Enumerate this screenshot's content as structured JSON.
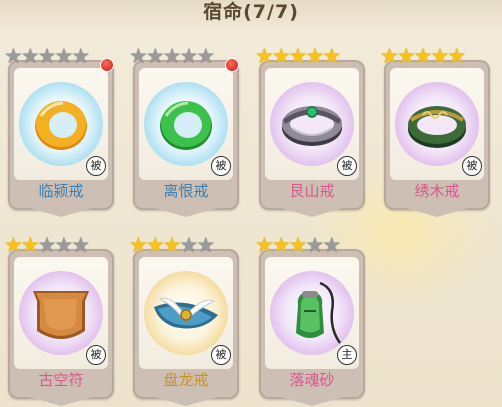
{
  "header": {
    "title": "宿命(7/7)"
  },
  "cards": [
    {
      "name": "临颍戒",
      "stars": 0,
      "max_stars": 5,
      "badge": "被",
      "color": "blue",
      "alert": true,
      "icon": "orange-ring-icon"
    },
    {
      "name": "离恨戒",
      "stars": 0,
      "max_stars": 5,
      "badge": "被",
      "color": "blue",
      "alert": true,
      "icon": "green-ring-icon"
    },
    {
      "name": "艮山戒",
      "stars": 5,
      "max_stars": 5,
      "badge": "被",
      "color": "purple",
      "alert": false,
      "icon": "silver-gem-ring-icon"
    },
    {
      "name": "绣木戒",
      "stars": 5,
      "max_stars": 5,
      "badge": "被",
      "color": "purple",
      "alert": false,
      "icon": "jade-ring-icon"
    },
    {
      "name": "古空符",
      "stars": 2,
      "max_stars": 5,
      "badge": "被",
      "color": "purple",
      "alert": false,
      "icon": "bronze-shield-icon"
    },
    {
      "name": "盘龙戒",
      "stars": 3,
      "max_stars": 5,
      "badge": "被",
      "color": "gold",
      "alert": false,
      "icon": "winged-hat-icon"
    },
    {
      "name": "落魂砂",
      "stars": 3,
      "max_stars": 5,
      "badge": "主",
      "color": "purple",
      "alert": false,
      "icon": "sand-pouch-icon"
    }
  ],
  "colors": {
    "blue": "#3d7fb3",
    "purple": "#d8588f",
    "gold": "#c69326"
  }
}
